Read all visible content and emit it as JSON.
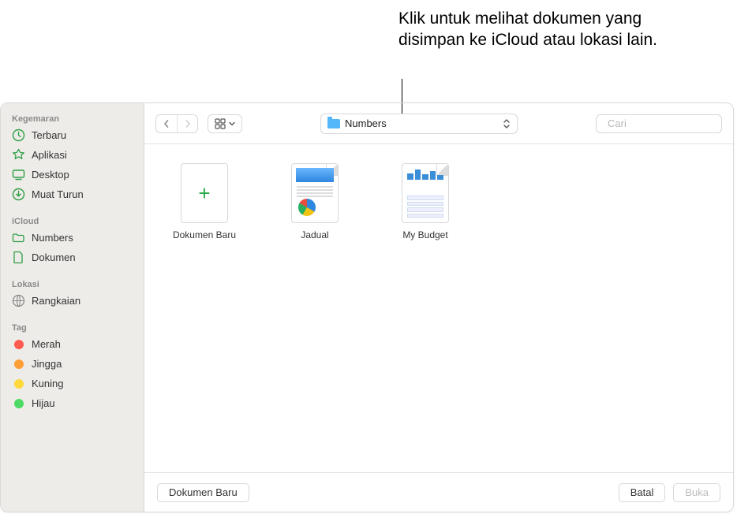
{
  "callout": "Klik untuk melihat dokumen yang disimpan ke iCloud atau lokasi lain.",
  "sidebar": {
    "sections": [
      {
        "header": "Kegemaran",
        "items": [
          {
            "label": "Terbaru",
            "icon": "recent"
          },
          {
            "label": "Aplikasi",
            "icon": "apps"
          },
          {
            "label": "Desktop",
            "icon": "desktop"
          },
          {
            "label": "Muat Turun",
            "icon": "downloads"
          }
        ]
      },
      {
        "header": "iCloud",
        "items": [
          {
            "label": "Numbers",
            "icon": "folder"
          },
          {
            "label": "Dokumen",
            "icon": "document"
          }
        ]
      },
      {
        "header": "Lokasi",
        "items": [
          {
            "label": "Rangkaian",
            "icon": "network"
          }
        ]
      },
      {
        "header": "Tag",
        "items": [
          {
            "label": "Merah",
            "color": "#ff5b4f"
          },
          {
            "label": "Jingga",
            "color": "#ff9d36"
          },
          {
            "label": "Kuning",
            "color": "#ffd93a"
          },
          {
            "label": "Hijau",
            "color": "#4cd964"
          }
        ]
      }
    ]
  },
  "toolbar": {
    "path_label": "Numbers",
    "search_placeholder": "Cari"
  },
  "files": [
    {
      "label": "Dokumen Baru",
      "kind": "new"
    },
    {
      "label": "Jadual",
      "kind": "jadual"
    },
    {
      "label": "My Budget",
      "kind": "budget"
    }
  ],
  "footer": {
    "new_doc": "Dokumen Baru",
    "cancel": "Batal",
    "open": "Buka"
  },
  "colors": {
    "sidebar_icon": "#2f9e44"
  }
}
